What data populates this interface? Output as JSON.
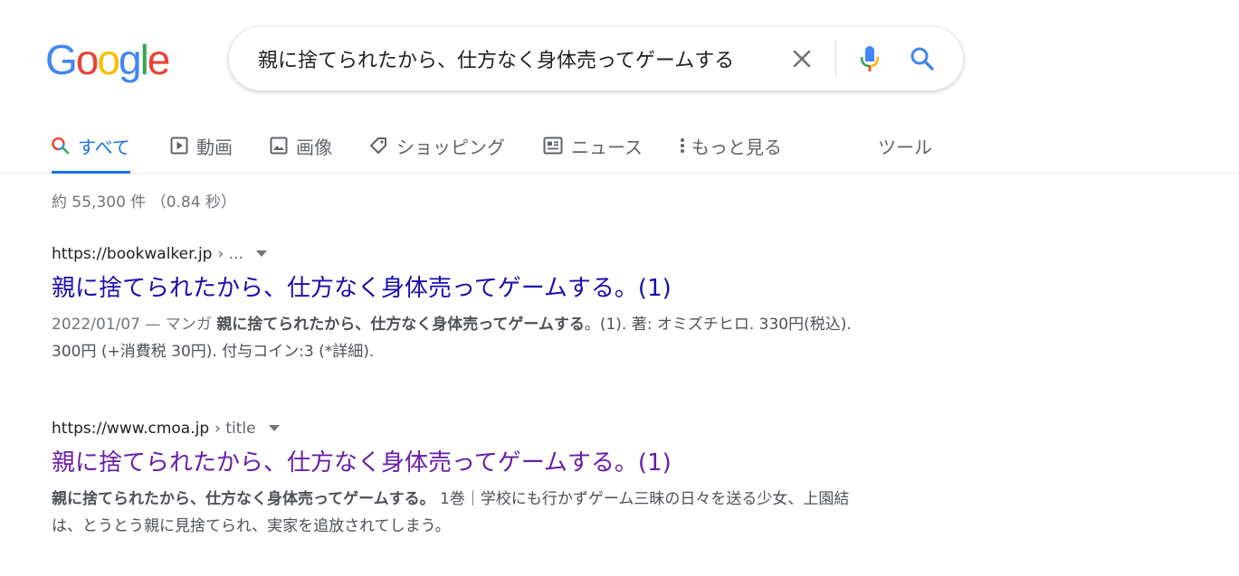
{
  "logo": {
    "letters": [
      "G",
      "o",
      "o",
      "g",
      "l",
      "e"
    ],
    "colors": [
      "#4285f4",
      "#ea4335",
      "#fbbc05",
      "#4285f4",
      "#34a853",
      "#ea4335"
    ]
  },
  "search": {
    "query": "親に捨てられたから、仕方なく身体売ってゲームする"
  },
  "tabs": [
    {
      "label": "すべて",
      "icon": "search-icon",
      "active": true
    },
    {
      "label": "動画",
      "icon": "play-icon"
    },
    {
      "label": "画像",
      "icon": "image-icon"
    },
    {
      "label": "ショッピング",
      "icon": "tag-icon"
    },
    {
      "label": "ニュース",
      "icon": "news-icon"
    },
    {
      "label": "もっと見る",
      "icon": "more-vert-icon"
    },
    {
      "label": "ツール"
    }
  ],
  "stats": "約 55,300 件 （0.84 秒）",
  "results": [
    {
      "url": "https://bookwalker.jp",
      "crumb": "› ...",
      "title": "親に捨てられたから、仕方なく身体売ってゲームする。(1)",
      "snippet_date": "2022/01/07 — マンガ ",
      "snippet_bold": "親に捨てられたから、仕方なく身体売ってゲームする",
      "snippet_rest": "。(1). 著: オミズチヒロ. 330円(税込). 300円 (+消費税 30円). 付与コイン:3 (*詳細).",
      "visited": false
    },
    {
      "url": "https://www.cmoa.jp",
      "crumb": "› title",
      "title": "親に捨てられたから、仕方なく身体売ってゲームする。(1)",
      "snippet_bold": "親に捨てられたから、仕方なく身体売ってゲームする。",
      "snippet_rest": " 1巻｜学校にも行かずゲーム三昧の日々を送る少女、上園結は、とうとう親に見捨てられ、実家を追放されてしまう。",
      "visited": true
    }
  ],
  "colors": {
    "link": "#1a0dab",
    "visited": "#681da8",
    "accent": "#1a73e8"
  }
}
